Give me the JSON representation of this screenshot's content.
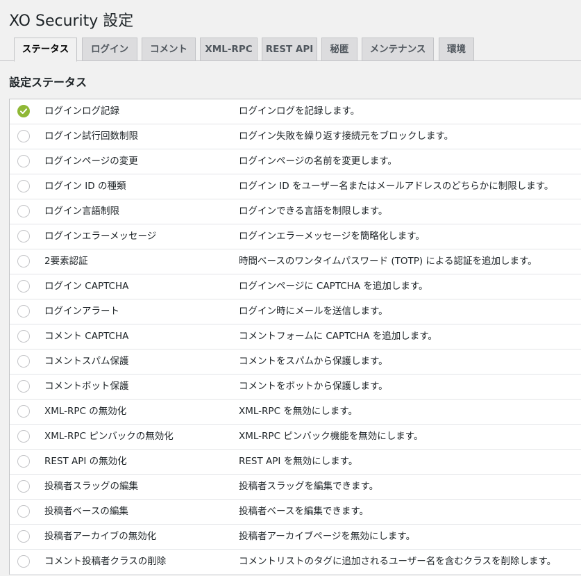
{
  "page": {
    "title": "XO Security 設定"
  },
  "tabs": [
    {
      "label": "ステータス",
      "active": true
    },
    {
      "label": "ログイン",
      "active": false
    },
    {
      "label": "コメント",
      "active": false
    },
    {
      "label": "XML-RPC",
      "active": false
    },
    {
      "label": "REST API",
      "active": false
    },
    {
      "label": "秘匿",
      "active": false
    },
    {
      "label": "メンテナンス",
      "active": false
    },
    {
      "label": "環境",
      "active": false
    }
  ],
  "section": {
    "title": "設定ステータス"
  },
  "status_rows": [
    {
      "enabled": true,
      "name": "ログインログ記録",
      "description": "ログインログを記録します。"
    },
    {
      "enabled": false,
      "name": "ログイン試行回数制限",
      "description": "ログイン失敗を繰り返す接続元をブロックします。"
    },
    {
      "enabled": false,
      "name": "ログインページの変更",
      "description": "ログインページの名前を変更します。"
    },
    {
      "enabled": false,
      "name": "ログイン ID の種類",
      "description": "ログイン ID をユーザー名またはメールアドレスのどちらかに制限します。"
    },
    {
      "enabled": false,
      "name": "ログイン言語制限",
      "description": "ログインできる言語を制限します。"
    },
    {
      "enabled": false,
      "name": "ログインエラーメッセージ",
      "description": "ログインエラーメッセージを簡略化します。"
    },
    {
      "enabled": false,
      "name": "2要素認証",
      "description": "時間ベースのワンタイムパスワード (TOTP) による認証を追加します。"
    },
    {
      "enabled": false,
      "name": "ログイン CAPTCHA",
      "description": "ログインページに CAPTCHA を追加します。"
    },
    {
      "enabled": false,
      "name": "ログインアラート",
      "description": "ログイン時にメールを送信します。"
    },
    {
      "enabled": false,
      "name": "コメント CAPTCHA",
      "description": "コメントフォームに CAPTCHA を追加します。"
    },
    {
      "enabled": false,
      "name": "コメントスパム保護",
      "description": "コメントをスパムから保護します。"
    },
    {
      "enabled": false,
      "name": "コメントボット保護",
      "description": "コメントをボットから保護します。"
    },
    {
      "enabled": false,
      "name": "XML-RPC の無効化",
      "description": "XML-RPC を無効にします。"
    },
    {
      "enabled": false,
      "name": "XML-RPC ピンバックの無効化",
      "description": "XML-RPC ピンバック機能を無効にします。"
    },
    {
      "enabled": false,
      "name": "REST API の無効化",
      "description": "REST API を無効にします。"
    },
    {
      "enabled": false,
      "name": "投稿者スラッグの編集",
      "description": "投稿者スラッグを編集できます。"
    },
    {
      "enabled": false,
      "name": "投稿者ベースの編集",
      "description": "投稿者ベースを編集できます。"
    },
    {
      "enabled": false,
      "name": "投稿者アーカイブの無効化",
      "description": "投稿者アーカイブページを無効にします。"
    },
    {
      "enabled": false,
      "name": "コメント投稿者クラスの削除",
      "description": "コメントリストのタグに追加されるユーザー名を含むクラスを削除します。"
    }
  ],
  "icons": {
    "enabled": "check-circle-icon",
    "disabled": "empty-circle-icon"
  },
  "colors": {
    "enabled": "#8fb836",
    "disabled_border": "#c3c4c7"
  }
}
